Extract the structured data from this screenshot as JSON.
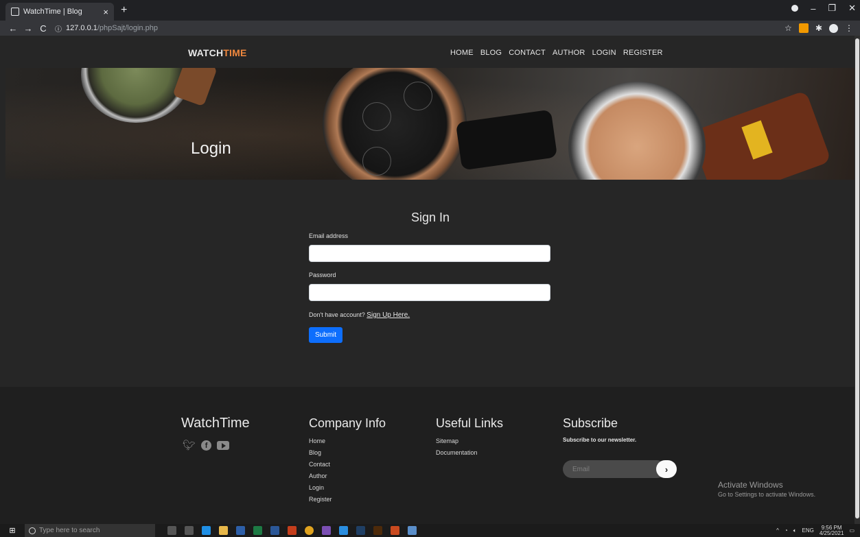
{
  "browser": {
    "tab_title": "WatchTime | Blog",
    "tab_close": "×",
    "new_tab": "+",
    "url_host": "127.0.0.1",
    "url_path": "/phpSajt/login.php",
    "url_info": "ⓘ"
  },
  "site": {
    "logo_main": "WATCH",
    "logo_accent": "TIME",
    "accent_color": "#f0883e",
    "nav": [
      "HOME",
      "BLOG",
      "CONTACT",
      "AUTHOR",
      "LOGIN",
      "REGISTER"
    ]
  },
  "hero": {
    "title": "Login"
  },
  "signin": {
    "title": "Sign In",
    "email_label": "Email address",
    "email_value": "",
    "password_label": "Password",
    "password_value": "",
    "account_text": "Don't have account?",
    "signup_link": "Sign Up Here.",
    "submit_label": "Submit",
    "submit_color": "#0d6efd"
  },
  "footer": {
    "brand": "WatchTime",
    "social_icons": [
      "twitter-icon",
      "facebook-icon",
      "youtube-icon"
    ],
    "company_title": "Company Info",
    "company_links": [
      "Home",
      "Blog",
      "Contact",
      "Author",
      "Login",
      "Register"
    ],
    "useful_title": "Useful Links",
    "useful_links": [
      "Sitemap",
      "Documentation"
    ],
    "subscribe_title": "Subscribe",
    "subscribe_note": "Subscribe to our newsletter.",
    "subscribe_placeholder": "Email",
    "subscribe_button": "›"
  },
  "watermark": {
    "line1": "Activate Windows",
    "line2": "Go to Settings to activate Windows."
  },
  "taskbar": {
    "search_placeholder": "Type here to search",
    "lang": "ENG",
    "time": "9:56 PM",
    "date": "4/25/2021"
  }
}
